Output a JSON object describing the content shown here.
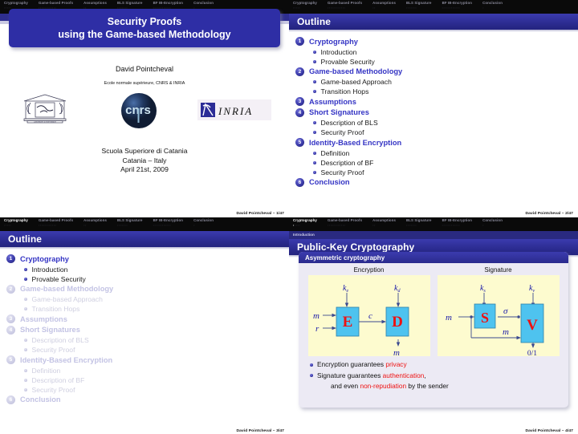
{
  "navigation": {
    "sections": [
      {
        "label": "Cryptography",
        "dots": 5
      },
      {
        "label": "Game-based Proofs",
        "dots": 12
      },
      {
        "label": "Assumptions",
        "dots": 2
      },
      {
        "label": "BLS Signature",
        "dots": 7
      },
      {
        "label": "BF IB-Encryption",
        "dots": 12
      },
      {
        "label": "Conclusion",
        "dots": 1
      }
    ]
  },
  "slide1": {
    "title_line1": "Security Proofs",
    "title_line2": "using the Game-based Methodology",
    "author": "David Pointcheval",
    "affiliation": "Ecole normale supérieure, CNRS & INRIA",
    "logos": [
      "ens-logo",
      "cnrs-logo",
      "inria-logo"
    ],
    "venue_line1": "Scuola Superiore di Catania",
    "venue_line2": "Catania – Italy",
    "venue_line3": "April 21st, 2009",
    "footer": "David Pointcheval – 1/47"
  },
  "slide2": {
    "title": "Outline",
    "footer": "David Pointcheval – 2/47",
    "sections": [
      {
        "num": "1",
        "label": "Cryptography",
        "sub": [
          "Introduction",
          "Provable Security"
        ]
      },
      {
        "num": "2",
        "label": "Game-based Methodology",
        "sub": [
          "Game-based Approach",
          "Transition Hops"
        ]
      },
      {
        "num": "3",
        "label": "Assumptions",
        "sub": []
      },
      {
        "num": "4",
        "label": "Short Signatures",
        "sub": [
          "Description of BLS",
          "Security Proof"
        ]
      },
      {
        "num": "5",
        "label": "Identity-Based Encryption",
        "sub": [
          "Definition",
          "Description of BF",
          "Security Proof"
        ]
      },
      {
        "num": "6",
        "label": "Conclusion",
        "sub": []
      }
    ]
  },
  "slide3": {
    "title": "Outline",
    "footer": "David Pointcheval – 3/47",
    "active_section": "Cryptography",
    "sections": [
      {
        "num": "1",
        "label": "Cryptography",
        "dimmed": false,
        "sub": [
          "Introduction",
          "Provable Security"
        ]
      },
      {
        "num": "2",
        "label": "Game-based Methodology",
        "dimmed": true,
        "sub": [
          "Game-based Approach",
          "Transition Hops"
        ]
      },
      {
        "num": "3",
        "label": "Assumptions",
        "dimmed": true,
        "sub": []
      },
      {
        "num": "4",
        "label": "Short Signatures",
        "dimmed": true,
        "sub": [
          "Description of BLS",
          "Security Proof"
        ]
      },
      {
        "num": "5",
        "label": "Identity-Based Encryption",
        "dimmed": true,
        "sub": [
          "Definition",
          "Description of BF",
          "Security Proof"
        ]
      },
      {
        "num": "6",
        "label": "Conclusion",
        "dimmed": true,
        "sub": []
      }
    ]
  },
  "slide4": {
    "subbar": "Introduction",
    "title": "Public-Key Cryptography",
    "footer": "David Pointcheval – 4/47",
    "active_section": "Cryptography",
    "active_dot_index": 0,
    "block_title": "Asymmetric cryptography",
    "encryption": {
      "caption": "Encryption",
      "input_message": "m",
      "input_random": "r",
      "key_encrypt": "k",
      "key_encrypt_sub": "e",
      "key_decrypt": "k",
      "key_decrypt_sub": "d",
      "box_encrypt": "E",
      "box_decrypt": "D",
      "ciphertext": "c",
      "output": "m"
    },
    "signature": {
      "caption": "Signature",
      "input_message": "m",
      "key_sign": "k",
      "key_sign_sub": "s",
      "key_verify": "k",
      "key_verify_sub": "v",
      "box_sign": "S",
      "box_verify": "V",
      "signature_symbol": "σ",
      "passthrough_message": "m",
      "output": "0/1"
    },
    "bullets": [
      {
        "pre": "Encryption guarantees ",
        "hl": "privacy",
        "post": ""
      },
      {
        "pre": "Signature guarantees ",
        "hl": "authentication",
        "post": ","
      }
    ],
    "bullet2_cont_pre": "and even ",
    "bullet2_cont_hl": "non-repudiation",
    "bullet2_cont_post": " by the sender"
  },
  "colors": {
    "beamer_blue": "#2e2ea5",
    "title_bar": "#2d2d93",
    "navbar_black": "#0a0a0a",
    "subbar_blue": "#2a2a80",
    "diagram_bg": "#fdfbcf",
    "diagram_box": "#4ec3ef",
    "diagram_letter": "#ee1111",
    "highlight_red": "#ee1111",
    "dim_gray": "#c9c9e2"
  }
}
